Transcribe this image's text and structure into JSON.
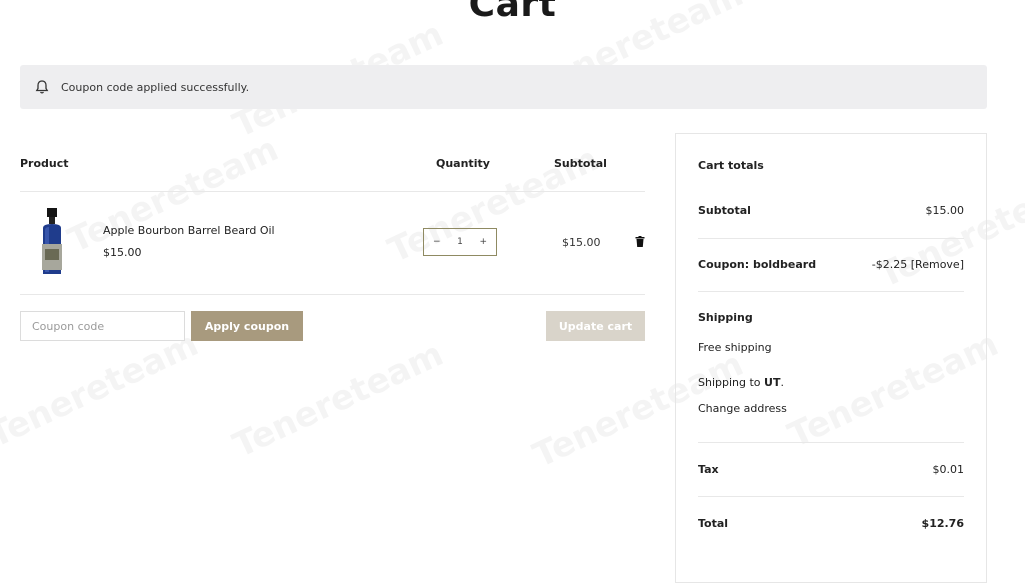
{
  "page": {
    "title": "Cart"
  },
  "notice": {
    "icon": "bell-icon",
    "message": "Coupon code applied successfully."
  },
  "table": {
    "headers": {
      "product": "Product",
      "quantity": "Quantity",
      "subtotal": "Subtotal"
    },
    "rows": [
      {
        "name": "Apple Bourbon Barrel Beard Oil",
        "price": "$15.00",
        "quantity": "1",
        "qty_minus": "−",
        "qty_plus": "+",
        "subtotal": "$15.00",
        "remove_icon": "trash-icon"
      }
    ]
  },
  "coupon": {
    "placeholder": "Coupon code",
    "value": "",
    "apply_label": "Apply coupon"
  },
  "update_label": "Update cart",
  "totals": {
    "title": "Cart totals",
    "subtotal_label": "Subtotal",
    "subtotal_value": "$15.00",
    "coupon_label": "Coupon: boldbeard",
    "coupon_value": "-$2.25",
    "coupon_remove": "[Remove]",
    "shipping_label": "Shipping",
    "shipping_method": "Free shipping",
    "shipping_to_prefix": "Shipping to ",
    "shipping_to_state": "UT",
    "shipping_to_suffix": ".",
    "change_address": "Change address",
    "tax_label": "Tax",
    "tax_value": "$0.01",
    "total_label": "Total",
    "total_value": "$12.76"
  },
  "watermark": "Tenereteam",
  "colors": {
    "apply_button": "#a89a7e",
    "update_button": "#d9d4ca",
    "notice_bg": "#eeeef0",
    "qty_border": "#8f8a62"
  }
}
